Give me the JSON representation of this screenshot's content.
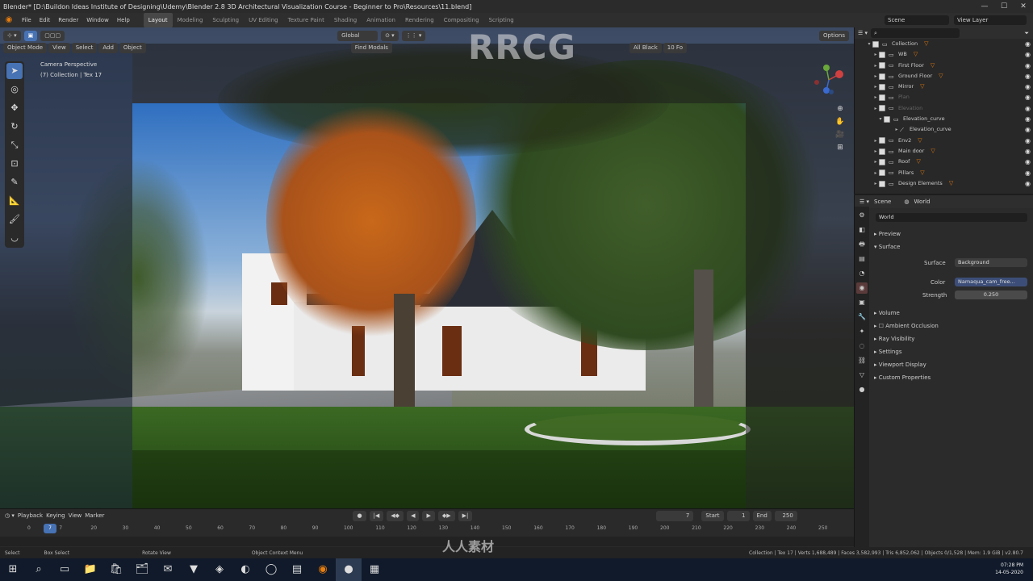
{
  "window": {
    "title": "Blender* [D:\\Buildon Ideas Institute of Designing\\Udemy\\Blender 2.8 3D Architectural Visualization Course - Beginner to Pro\\Resources\\11.blend]",
    "controls": [
      "—",
      "☐",
      "✕"
    ]
  },
  "menu": {
    "items": [
      "File",
      "Edit",
      "Render",
      "Window",
      "Help"
    ],
    "workspaces": [
      "Layout",
      "Modeling",
      "Sculpting",
      "UV Editing",
      "Texture Paint",
      "Shading",
      "Animation",
      "Rendering",
      "Compositing",
      "Scripting"
    ],
    "active_workspace": "Layout",
    "scene_label": "Scene",
    "view_layer_label": "View Layer"
  },
  "viewport": {
    "mode": "Object Mode",
    "header_menus": [
      "View",
      "Select",
      "Add",
      "Object"
    ],
    "orientation": "Global",
    "find_label": "Find Modals",
    "options_label": "Options",
    "camera_info": [
      "Camera Perspective",
      "(7) Collection | Tex 17"
    ],
    "overlay_label": "All Black",
    "zoom_label": "10 Fo",
    "watermark": "RRCG",
    "tools": [
      "cursor-tool",
      "select-circle-tool",
      "move-tool",
      "rotate-tool",
      "scale-tool",
      "transform-tool",
      "annotate-tool",
      "measure-tool",
      "brush-tool",
      "extra-tool"
    ]
  },
  "outliner": {
    "search_placeholder": "",
    "rows": [
      {
        "name": "Collection",
        "dim": false
      },
      {
        "name": "WB",
        "dim": false
      },
      {
        "name": "First Floor",
        "dim": false
      },
      {
        "name": "Ground Floor",
        "dim": false
      },
      {
        "name": "Mirror",
        "dim": false
      },
      {
        "name": "Plan",
        "dim": true
      },
      {
        "name": "Elevation",
        "dim": true
      },
      {
        "name": "Elevation_curve",
        "dim": false
      },
      {
        "name": "Elevation_curve",
        "dim": false
      },
      {
        "name": "Env2",
        "dim": false
      },
      {
        "name": "Main door",
        "dim": false
      },
      {
        "name": "Roof",
        "dim": false
      },
      {
        "name": "Pillars",
        "dim": false
      },
      {
        "name": "Design Elements",
        "dim": false
      }
    ]
  },
  "properties": {
    "header_scene": "Scene",
    "header_world": "World",
    "world_name": "World",
    "sections": [
      "Preview",
      "Surface"
    ],
    "surface_label": "Surface",
    "surface_value": "Background",
    "color_label": "Color",
    "color_value": "Namaqua_cam_free...",
    "strength_label": "Strength",
    "strength_value": "0.250",
    "more_sections": [
      "Volume",
      "Ambient Occlusion",
      "Ray Visibility",
      "Settings",
      "Viewport Display",
      "Custom Properties"
    ]
  },
  "timeline": {
    "menus": [
      "Playback",
      "Keying",
      "View",
      "Marker"
    ],
    "current_frame": "7",
    "start_label": "Start",
    "start_value": "1",
    "end_label": "End",
    "end_value": "250",
    "ruler": [
      "0",
      "7",
      "20",
      "30",
      "40",
      "50",
      "60",
      "70",
      "80",
      "90",
      "100",
      "110",
      "120",
      "130",
      "140",
      "150",
      "160",
      "170",
      "180",
      "190",
      "200",
      "210",
      "220",
      "230",
      "240",
      "250"
    ]
  },
  "statusbar": {
    "items": [
      "Select",
      "Box Select",
      "Rotate View",
      "Object Context Menu"
    ],
    "stats": "Collection | Tex 17 | Verts 1,688,489 | Faces 3,582,993 | Tris 6,852,062 | Objects 0/1,528 | Mem: 1.9 GiB | v2.80.7"
  },
  "taskbar": {
    "apps": [
      "start-icon",
      "search-icon",
      "task-view-icon",
      "file-explorer-icon",
      "store-icon",
      "folder-icon",
      "mail-icon",
      "brave-icon",
      "app-icon",
      "browser-icon",
      "blender-icon",
      "chrome-icon",
      "note-icon"
    ],
    "time": "07:28 PM",
    "date": "14-05-2020"
  },
  "bottom_watermark": "人人素材"
}
